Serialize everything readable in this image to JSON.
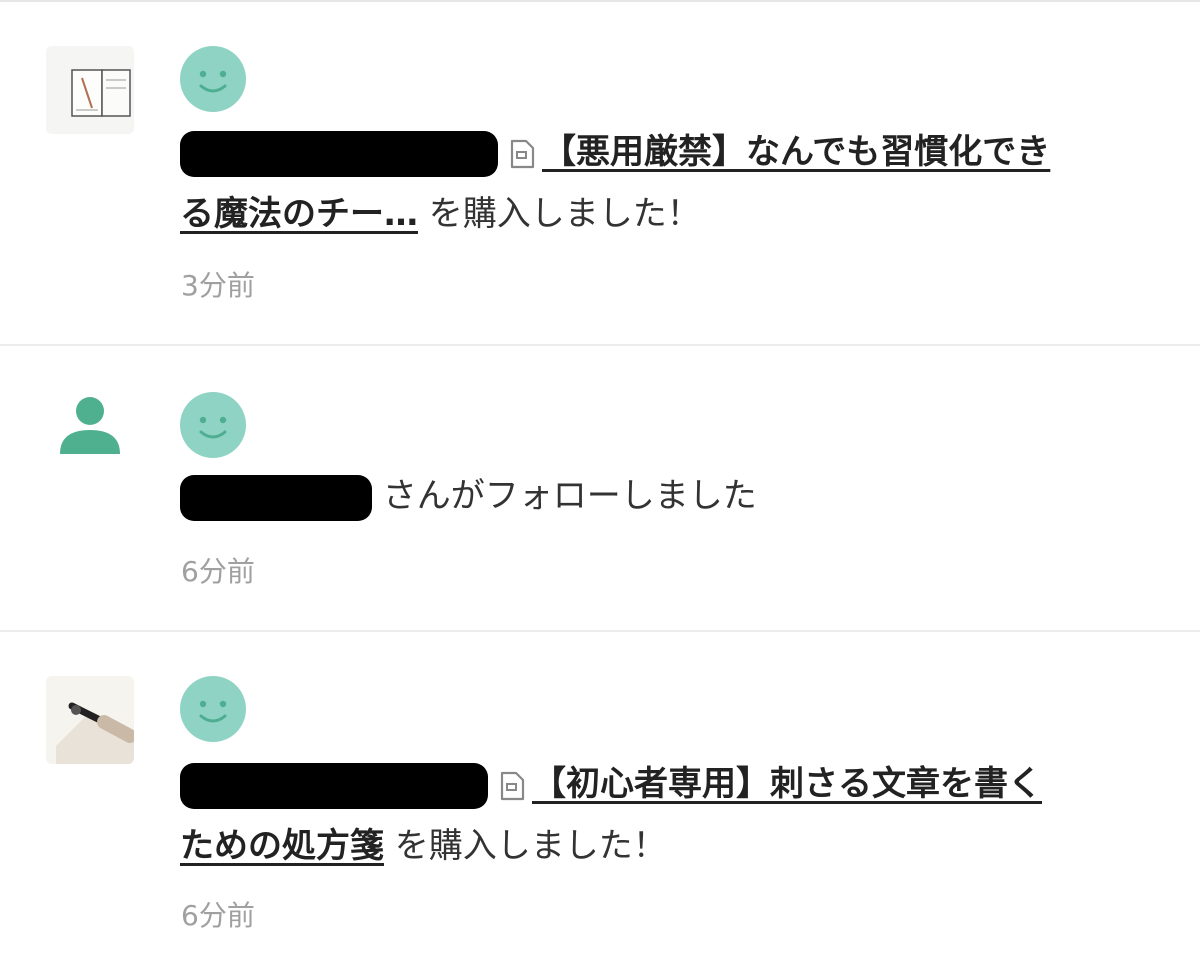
{
  "notifications": [
    {
      "title_line1": "【悪用厳禁】なんでも習慣化でき",
      "title_line2": "る魔法のチー…",
      "action": " を購入しました！",
      "time": "3分前"
    },
    {
      "action": " さんがフォローしました",
      "time": "6分前"
    },
    {
      "title_line1": "【初心者専用】刺さる文章を書く",
      "title_line2": "ための処方箋",
      "action": " を購入しました！",
      "time": "6分前"
    }
  ],
  "icons": {
    "avatar": "smiley-face-icon",
    "follow": "person-icon",
    "article": "document-icon",
    "thumb1": "notebook-thumbnail",
    "thumb2": "pen-writing-thumbnail"
  },
  "colors": {
    "accent": "#8fd3c4",
    "follow_icon": "#4fb08f",
    "time_text": "#a0a0a0",
    "divider": "#ececec"
  }
}
